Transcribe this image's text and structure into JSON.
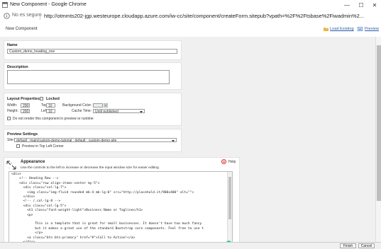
{
  "window": {
    "title": "New Component - Google Chrome",
    "controls": {
      "minimize": "—",
      "maximize": "☐",
      "close": "✕"
    }
  },
  "address": {
    "insecure_label": "No es seguro",
    "url": "http://otmmts202-jgp.westeurope.cloudapp.azure.com/iw-cc/site/component/createForm.sitepub?vpath=%2F%2Ftsbase%2Fiwadmin%2..."
  },
  "header": {
    "title": "New Component",
    "load_existing": "Load Existing",
    "preview": "Preview"
  },
  "name_section": {
    "label": "Name",
    "value": "Custom_demo_heading_row"
  },
  "description_section": {
    "label": "Description",
    "value": ""
  },
  "layout": {
    "label": "Layout Properties",
    "locked_label": "Locked",
    "width_label": "Width:",
    "width_value": "200",
    "height_label": "Height:",
    "height_value": "200",
    "top_label": "Top:",
    "top_value": "10",
    "left_label": "Left:",
    "left_value": "10",
    "bg_label": "Background Color:",
    "bg_value": "",
    "cache_label": "Cache Time:",
    "cache_value": "Until published",
    "no_render_label": "Do not render this component in preview or runtime"
  },
  "preview_settings": {
    "label": "Preview Settings",
    "site_label": "Site:",
    "site_value": "default : main/custom-demo-tutorial : default : custom-demo-site",
    "top_left_label": "Preview in Top Left Corner"
  },
  "appearance": {
    "title": "Appearance",
    "instructions": "Use the controls to the left to increase or decrease the input window size for easier editing.",
    "help_label": "Help",
    "code": "<div>\n    <!-- Heading Row -->\n    <div class=\"row align-items-center my-5\">\n      <div class=\"col-lg-7\">\n        <img class=\"img-fluid rounded mb-4 mb-lg-0\" src=\"http://placehold.it/900x400\" alt=\"\">\n      </div>\n      <!-- /.col-lg-8 -->\n      <div class=\"col-lg-5\">\n        <h1 class=\"font-weight-light\">Business Name or Tagline</h1>\n        <p>\n\n            This is a template that is great for small businesses. It doesn't have too much fancy\n            but it makes a great use of the standard Bootstrap core components. Feel free to use t\n            </p>\n        <a class=\"btn btn-primary\" href=\"#\">Call to Action!</a>\n      </div>"
  },
  "footer": {
    "finish": "Finish",
    "cancel": "Cancel"
  },
  "colors": {
    "link": "#2b5aa3",
    "help_icon": "#d9342b",
    "bg": "#f0f0f0"
  }
}
